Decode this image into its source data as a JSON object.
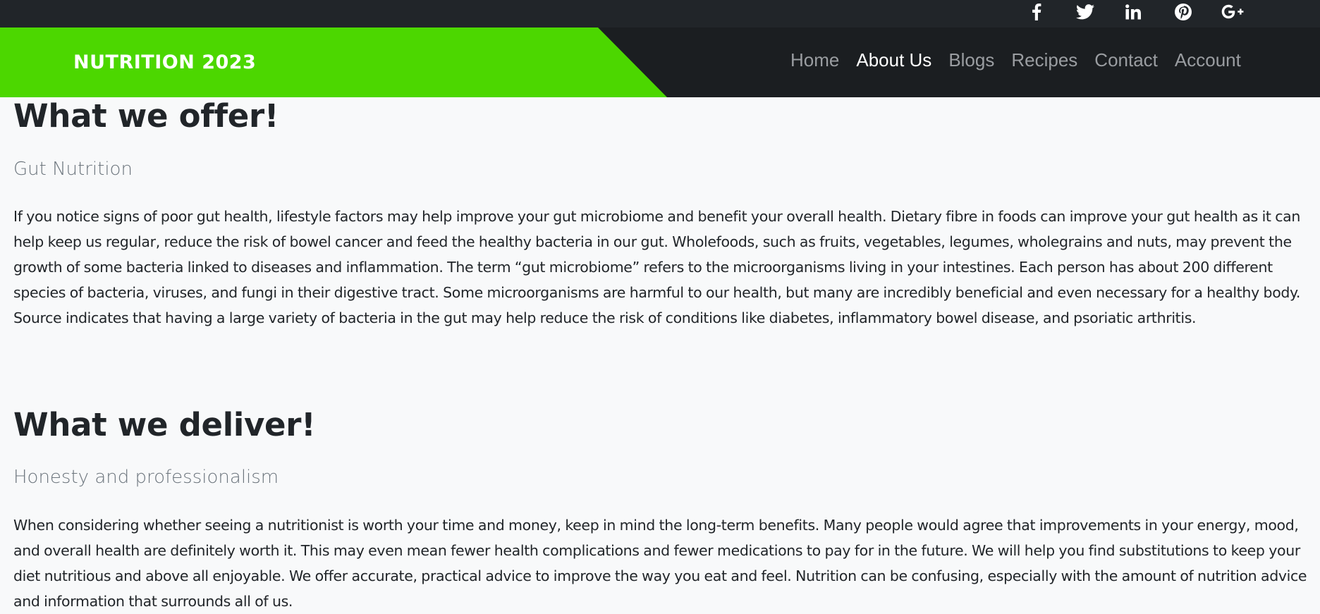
{
  "social": {
    "facebook_icon": "facebook-icon",
    "twitter_icon": "twitter-icon",
    "linkedin_icon": "linkedin-icon",
    "pinterest_icon": "pinterest-icon",
    "googleplus_icon": "google-plus-icon"
  },
  "brand": {
    "name": "NUTRITION 2023",
    "color": "#4cd700"
  },
  "nav": {
    "items": [
      {
        "label": "Home",
        "active": false
      },
      {
        "label": "About Us",
        "active": true
      },
      {
        "label": "Blogs",
        "active": false
      },
      {
        "label": "Recipes",
        "active": false
      },
      {
        "label": "Contact",
        "active": false
      },
      {
        "label": "Account",
        "active": false
      }
    ]
  },
  "sections": [
    {
      "title": "What we offer!",
      "subtitle": "Gut Nutrition",
      "body": "If you notice signs of poor gut health, lifestyle factors may help improve your gut microbiome and benefit your overall health. Dietary fibre in foods can improve your gut health as it can help keep us regular, reduce the risk of bowel cancer and feed the healthy bacteria in our gut. Wholefoods, such as fruits, vegetables, legumes, wholegrains and nuts, may prevent the growth of some bacteria linked to diseases and inflammation. The term “gut microbiome” refers to the microorganisms living in your intestines. Each person has about 200 different species of bacteria, viruses, and fungi in their digestive tract. Some microorganisms are harmful to our health, but many are incredibly beneficial and even necessary for a healthy body. Source indicates that having a large variety of bacteria in the gut may help reduce the risk of conditions like diabetes, inflammatory bowel disease, and psoriatic arthritis."
    },
    {
      "title": "What we deliver!",
      "subtitle": "Honesty and professionalism",
      "body": "When considering whether seeing a nutritionist is worth your time and money, keep in mind the long-term benefits. Many people would agree that improvements in your energy, mood, and overall health are definitely worth it. This may even mean fewer health complications and fewer medications to pay for in the future. We will help you find substitutions to keep your diet nutritious and above all enjoyable. We offer accurate, practical advice to improve the way you eat and feel. Nutrition can be confusing, especially with the amount of nutrition advice and information that surrounds all of us."
    }
  ]
}
